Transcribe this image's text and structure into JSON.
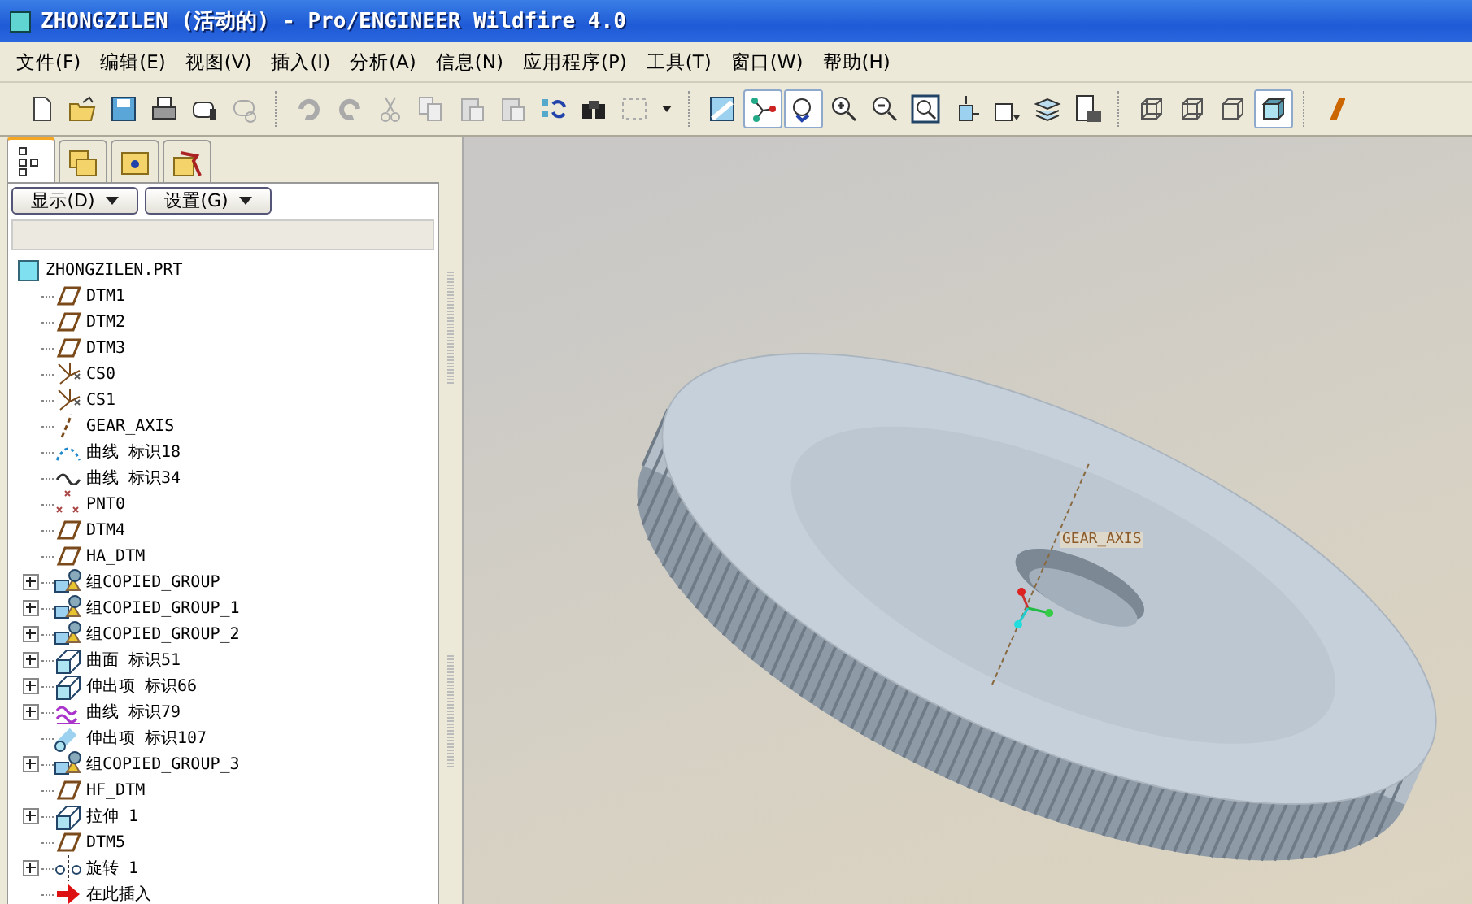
{
  "window": {
    "title": "ZHONGZILEN (活动的) - Pro/ENGINEER Wildfire 4.0"
  },
  "menu": [
    "文件(F)",
    "编辑(E)",
    "视图(V)",
    "插入(I)",
    "分析(A)",
    "信息(N)",
    "应用程序(P)",
    "工具(T)",
    "窗口(W)",
    "帮助(H)"
  ],
  "toolbar": [
    [
      {
        "kind": "new",
        "pressed": false
      },
      {
        "kind": "open",
        "pressed": false
      },
      {
        "kind": "save",
        "pressed": false
      },
      {
        "kind": "print",
        "pressed": false
      },
      {
        "kind": "mail",
        "pressed": false
      },
      {
        "kind": "link",
        "pressed": false
      }
    ],
    [
      {
        "kind": "undo",
        "pressed": false
      },
      {
        "kind": "redo",
        "pressed": false
      },
      {
        "kind": "cut",
        "pressed": false
      },
      {
        "kind": "copy",
        "pressed": false
      },
      {
        "kind": "paste",
        "pressed": false
      },
      {
        "kind": "paste",
        "pressed": false
      },
      {
        "kind": "regen",
        "pressed": false
      },
      {
        "kind": "find",
        "pressed": false
      },
      {
        "kind": "select",
        "pressed": false
      }
    ],
    [
      {
        "kind": "repaint",
        "pressed": false
      },
      {
        "kind": "datum",
        "pressed": true
      },
      {
        "kind": "spin",
        "pressed": true
      },
      {
        "kind": "zoomin",
        "pressed": false
      },
      {
        "kind": "zoomout",
        "pressed": false
      },
      {
        "kind": "refit",
        "pressed": false
      },
      {
        "kind": "orient",
        "pressed": false
      },
      {
        "kind": "view",
        "pressed": false
      },
      {
        "kind": "layers",
        "pressed": false
      },
      {
        "kind": "setup",
        "pressed": false
      }
    ],
    [
      {
        "kind": "wire",
        "pressed": false
      },
      {
        "kind": "wire",
        "pressed": false
      },
      {
        "kind": "cube",
        "pressed": false
      },
      {
        "kind": "shaded",
        "pressed": true
      }
    ],
    [
      {
        "kind": "plane",
        "pressed": false
      }
    ]
  ],
  "panel_tabs": [
    {
      "kind": "tree",
      "selected": true
    },
    {
      "kind": "folders",
      "selected": false
    },
    {
      "kind": "favorites",
      "selected": false
    },
    {
      "kind": "tools",
      "selected": false
    }
  ],
  "panel_buttons": [
    "显示(D)",
    "设置(G)"
  ],
  "tree": {
    "root": "ZHONGZILEN.PRT",
    "items": [
      {
        "label": "DTM1",
        "kind": "plane",
        "collapsed": false
      },
      {
        "label": "DTM2",
        "kind": "plane",
        "collapsed": false
      },
      {
        "label": "DTM3",
        "kind": "plane",
        "collapsed": false
      },
      {
        "label": "CS0",
        "kind": "csys",
        "collapsed": false
      },
      {
        "label": "CS1",
        "kind": "csys",
        "collapsed": false
      },
      {
        "label": "GEAR_AXIS",
        "kind": "axis",
        "collapsed": false
      },
      {
        "label": "曲线 标识18",
        "kind": "curve-dots",
        "collapsed": false
      },
      {
        "label": "曲线 标识34",
        "kind": "curve",
        "collapsed": false
      },
      {
        "label": "PNT0",
        "kind": "point",
        "collapsed": false
      },
      {
        "label": "DTM4",
        "kind": "plane",
        "collapsed": false
      },
      {
        "label": "HA_DTM",
        "kind": "plane",
        "collapsed": false
      },
      {
        "label": "组COPIED_GROUP",
        "kind": "group",
        "collapsed": true
      },
      {
        "label": "组COPIED_GROUP_1",
        "kind": "group",
        "collapsed": true
      },
      {
        "label": "组COPIED_GROUP_2",
        "kind": "group",
        "collapsed": true
      },
      {
        "label": "曲面 标识51",
        "kind": "extrude",
        "collapsed": true
      },
      {
        "label": "伸出项 标识66",
        "kind": "extrude",
        "collapsed": true
      },
      {
        "label": "曲线 标识79",
        "kind": "wave",
        "collapsed": true
      },
      {
        "label": "伸出项 标识107",
        "kind": "sweep",
        "collapsed": false
      },
      {
        "label": "组COPIED_GROUP_3",
        "kind": "group",
        "collapsed": true
      },
      {
        "label": "HF_DTM",
        "kind": "plane",
        "collapsed": false
      },
      {
        "label": "拉伸 1",
        "kind": "extrude",
        "collapsed": true
      },
      {
        "label": "DTM5",
        "kind": "plane",
        "collapsed": false
      },
      {
        "label": "旋转 1",
        "kind": "revolve",
        "collapsed": true
      },
      {
        "label": "在此插入",
        "kind": "insert",
        "collapsed": false
      }
    ]
  },
  "viewport": {
    "axis_label": "GEAR_AXIS"
  }
}
